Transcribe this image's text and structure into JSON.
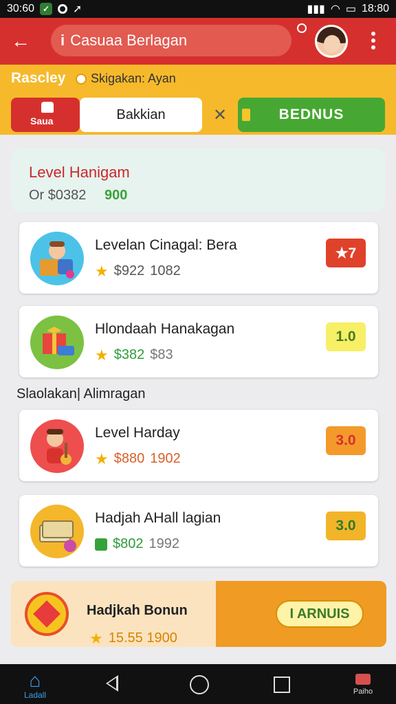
{
  "status_bar": {
    "left_time": "30:60",
    "right_time": "18:80"
  },
  "app_bar": {
    "title": "Casuaa Berlagan",
    "info_glyph": "i"
  },
  "header": {
    "title": "Rascley",
    "subtitle": "Skigakan: Ayan",
    "segments": [
      {
        "label": "Saua"
      },
      {
        "label": "Bakkian"
      },
      {
        "label": "BEDNUS"
      }
    ]
  },
  "level_card": {
    "title": "Level Hanigam",
    "subtitle": "Or $0382",
    "value": "900"
  },
  "items": [
    {
      "name": "Levelan Cinagal: Bera",
      "price": "$922",
      "extra": "1082",
      "badge": "★7",
      "icon": "kid-with-box-icon"
    },
    {
      "name": "Hlondaah Hanakagan",
      "price": "$382",
      "extra": "$83",
      "badge": "1.0",
      "icon": "gift-box-icon"
    }
  ],
  "section_label": "Slaolakan| Alimragan",
  "items2": [
    {
      "name": "Level Harday",
      "price": "$880",
      "extra": "1902",
      "badge": "3.0",
      "icon": "boy-with-guitar-icon"
    },
    {
      "name": "Hadjah AHall lagian",
      "price": "$802",
      "extra": "1992",
      "badge": "3.0",
      "icon": "money-stack-icon"
    }
  ],
  "bonus": {
    "title": "Hadjkah Bonun",
    "meta": "15.55 1900",
    "button": "I ARNUIS"
  },
  "nav": {
    "home_label": "Ladall",
    "profile_label": "Paiho"
  },
  "colors": {
    "red": "#d6302e",
    "yellow": "#f6b92b",
    "green": "#46a832",
    "orange": "#ef9b24"
  }
}
